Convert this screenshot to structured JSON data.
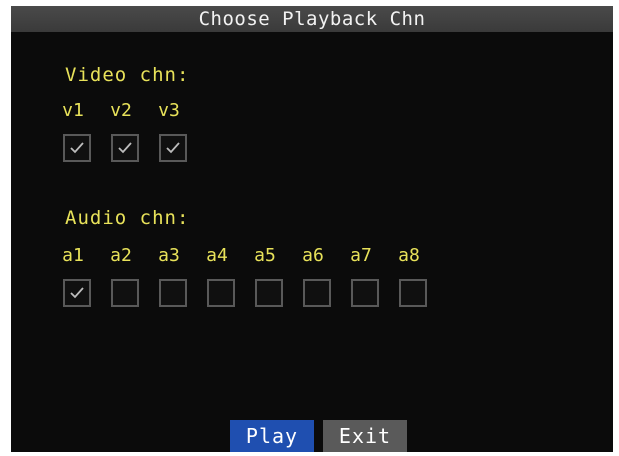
{
  "dialog": {
    "title": "Choose Playback Chn"
  },
  "video": {
    "label": "Video chn:",
    "channels": [
      {
        "label": "v1",
        "checked": true
      },
      {
        "label": "v2",
        "checked": true
      },
      {
        "label": "v3",
        "checked": true
      }
    ]
  },
  "audio": {
    "label": "Audio chn:",
    "channels": [
      {
        "label": "a1",
        "checked": true
      },
      {
        "label": "a2",
        "checked": false
      },
      {
        "label": "a3",
        "checked": false
      },
      {
        "label": "a4",
        "checked": false
      },
      {
        "label": "a5",
        "checked": false
      },
      {
        "label": "a6",
        "checked": false
      },
      {
        "label": "a7",
        "checked": false
      },
      {
        "label": "a8",
        "checked": false
      }
    ]
  },
  "buttons": {
    "play_label": "Play",
    "exit_label": "Exit"
  },
  "colors": {
    "label_text": "#e8e25a",
    "play_button": "#1f4fb0",
    "exit_button": "#5a5a5a",
    "background": "#0b0b0b"
  },
  "icons": {
    "checked": "checkmark-icon"
  }
}
